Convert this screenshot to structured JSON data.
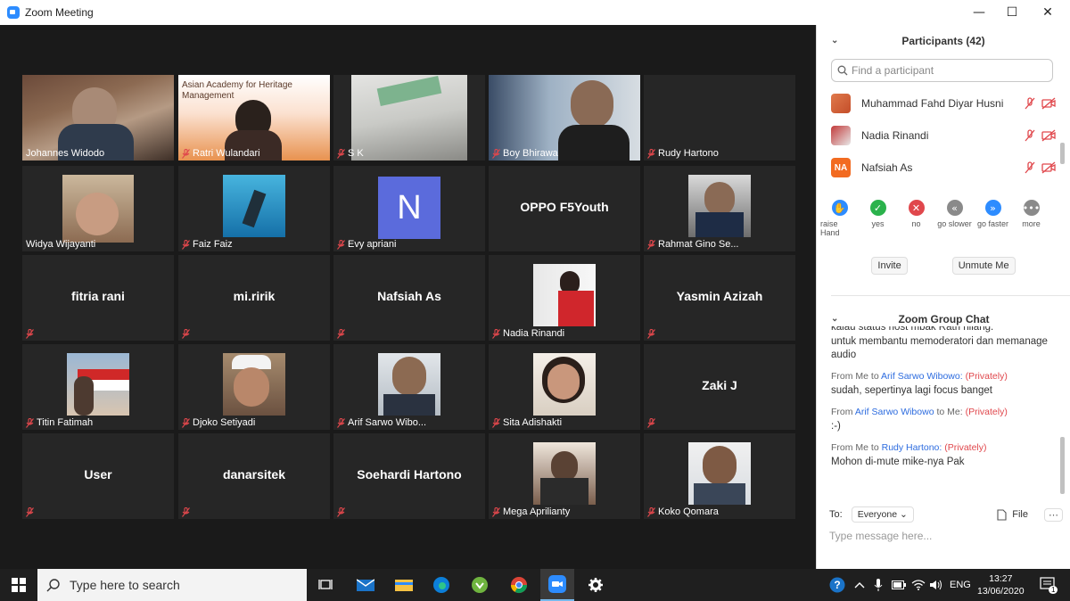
{
  "window": {
    "title": "Zoom Meeting",
    "minimize": "—",
    "maximize": "☐",
    "close": "✕"
  },
  "tiles": [
    {
      "name": "Johannes Widodo",
      "muted": false
    },
    {
      "name": "Ratri Wulandari",
      "muted": true,
      "slide_title": "Asian Academy for Heritage Management"
    },
    {
      "name": "S K",
      "muted": true
    },
    {
      "name": "Boy Bhirawa",
      "muted": true
    },
    {
      "name": "Rudy Hartono",
      "muted": true
    },
    {
      "name": "Widya Wijayanti",
      "muted": false
    },
    {
      "name": "Faiz Faiz",
      "muted": true
    },
    {
      "name": "Evy apriani",
      "muted": true,
      "initial": "N"
    },
    {
      "name": "OPPO F5Youth",
      "muted": false,
      "video": false
    },
    {
      "name": "Rahmat Gino Se...",
      "muted": true
    },
    {
      "name": "fitria rani",
      "muted": true,
      "video": false
    },
    {
      "name": "mi.ririk",
      "muted": true,
      "video": false
    },
    {
      "name": "Nafsiah As",
      "muted": true,
      "video": false
    },
    {
      "name": "Nadia Rinandi",
      "muted": true
    },
    {
      "name": "Yasmin Azizah",
      "muted": true,
      "video": false
    },
    {
      "name": "Titin Fatimah",
      "muted": true
    },
    {
      "name": "Djoko Setiyadi",
      "muted": true
    },
    {
      "name": "Arif Sarwo Wibo...",
      "muted": true
    },
    {
      "name": "Sita Adishakti",
      "muted": true
    },
    {
      "name": "Zaki J",
      "muted": true,
      "video": false
    },
    {
      "name": "User",
      "muted": true,
      "video": false
    },
    {
      "name": "danarsitek",
      "muted": true,
      "video": false
    },
    {
      "name": "Soehardi Hartono",
      "muted": true,
      "video": false
    },
    {
      "name": "Mega Aprilianty",
      "muted": true
    },
    {
      "name": "Koko Qomara",
      "muted": true
    }
  ],
  "participants": {
    "header": "Participants (42)",
    "search_placeholder": "Find a participant",
    "list": [
      {
        "name": "Muhammad Fahd Diyar Husni"
      },
      {
        "name": "Nadia Rinandi"
      },
      {
        "name": "Nafsiah As",
        "initials": "NA"
      }
    ],
    "reactions": [
      {
        "label": "raise Hand",
        "icon": "hand-icon",
        "color": "#2d8cff",
        "glyph": "✋"
      },
      {
        "label": "yes",
        "icon": "check-icon",
        "color": "#2bb24c",
        "glyph": "✓"
      },
      {
        "label": "no",
        "icon": "x-icon",
        "color": "#e0474c",
        "glyph": "✕"
      },
      {
        "label": "go slower",
        "icon": "rewind-icon",
        "color": "#8a8a8a",
        "glyph": "«"
      },
      {
        "label": "go faster",
        "icon": "fast-forward-icon",
        "color": "#2d8cff",
        "glyph": "»"
      },
      {
        "label": "more",
        "icon": "more-icon",
        "color": "#8a8a8a",
        "glyph": "•••"
      }
    ],
    "invite": "Invite",
    "unmute_me": "Unmute Me"
  },
  "chat": {
    "header": "Zoom Group Chat",
    "partial_line": "kalau status host mbak Ratri hilang.",
    "continued": "untuk membantu memoderatori dan memanage audio",
    "messages": [
      {
        "prefix": "From Me to",
        "user": "Arif Sarwo Wibowo:",
        "suffix": "",
        "private": "(Privately)",
        "text": "sudah, sepertinya lagi focus banget"
      },
      {
        "prefix": "From",
        "user": "Arif Sarwo Wibowo",
        "suffix": "to Me:",
        "private": "(Privately)",
        "text": ":-)"
      },
      {
        "prefix": "From Me to",
        "user": "Rudy Hartono:",
        "suffix": "",
        "private": "(Privately)",
        "text": "Mohon di-mute mike-nya Pak"
      }
    ],
    "to_label": "To:",
    "to_value": "Everyone",
    "file_label": "File",
    "input_placeholder": "Type message here..."
  },
  "taskbar": {
    "search_placeholder": "Type here to search",
    "time": "13:27",
    "date": "13/06/2020",
    "lang": "ENG",
    "notification_count": "1"
  }
}
